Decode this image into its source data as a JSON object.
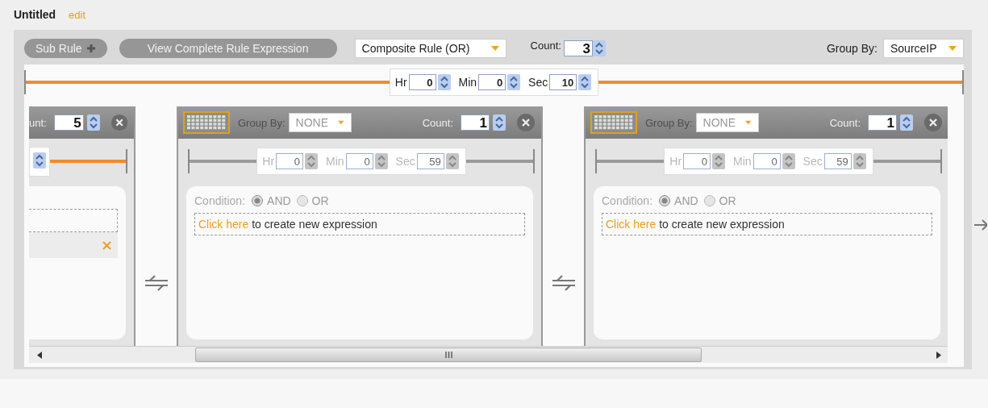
{
  "title": "Untitled",
  "edit_link": "edit",
  "toolbar": {
    "sub_rule_button": "Sub Rule",
    "view_button": "View Complete Rule Expression",
    "rule_type": "Composite Rule (OR)",
    "count_label": "Count:",
    "count": "3",
    "group_by_label": "Group By:",
    "group_by": "SourceIP"
  },
  "time_window": {
    "enabled": true,
    "fields": [
      {
        "label": "Hr",
        "value": "0"
      },
      {
        "label": "Min",
        "value": "0"
      },
      {
        "label": "Sec",
        "value": "10"
      }
    ]
  },
  "cards": [
    {
      "kind": "partial",
      "count_label": "unt:",
      "count": "5",
      "time_window": {
        "enabled": true
      }
    },
    {
      "kind": "full",
      "group_by_label": "Group By:",
      "group_by": "NONE",
      "count_label": "Count:",
      "count": "1",
      "time_window": {
        "enabled": false,
        "fields": [
          {
            "label": "Hr",
            "value": "0"
          },
          {
            "label": "Min",
            "value": "0"
          },
          {
            "label": "Sec",
            "value": "59"
          }
        ]
      },
      "condition_label": "Condition:",
      "conditions": [
        {
          "label": "AND",
          "selected": true
        },
        {
          "label": "OR",
          "selected": false
        }
      ],
      "link_text": "Click here",
      "prompt_text": "to create new expression"
    },
    {
      "kind": "full",
      "group_by_label": "Group By:",
      "group_by": "NONE",
      "count_label": "Count:",
      "count": "1",
      "time_window": {
        "enabled": false,
        "fields": [
          {
            "label": "Hr",
            "value": "0"
          },
          {
            "label": "Min",
            "value": "0"
          },
          {
            "label": "Sec",
            "value": "59"
          }
        ]
      },
      "condition_label": "Condition:",
      "conditions": [
        {
          "label": "AND",
          "selected": true
        },
        {
          "label": "OR",
          "selected": false
        }
      ],
      "link_text": "Click here",
      "prompt_text": "to create new expression"
    }
  ]
}
